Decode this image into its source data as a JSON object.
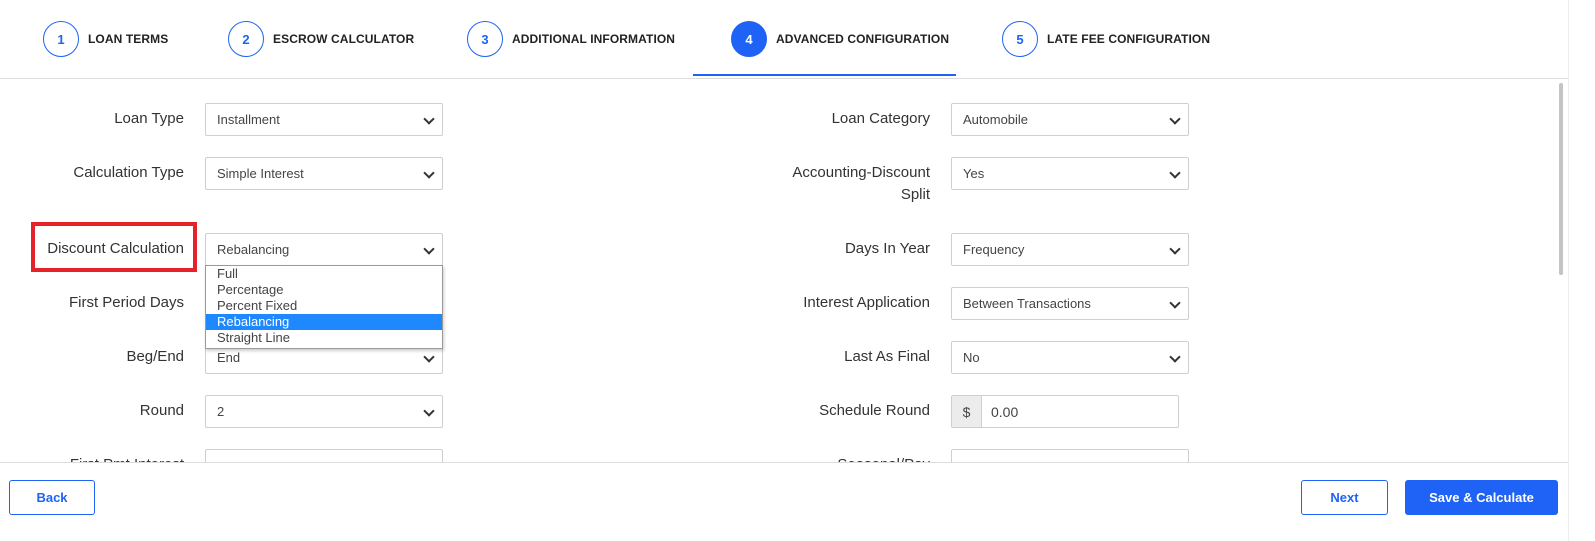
{
  "steps": [
    {
      "number": "1",
      "label": "LOAN TERMS"
    },
    {
      "number": "2",
      "label": "ESCROW CALCULATOR"
    },
    {
      "number": "3",
      "label": "ADDITIONAL INFORMATION"
    },
    {
      "number": "4",
      "label": "ADVANCED CONFIGURATION",
      "active": true
    },
    {
      "number": "5",
      "label": "LATE FEE CONFIGURATION"
    }
  ],
  "left_fields": {
    "loan_type": {
      "label": "Loan Type",
      "value": "Installment"
    },
    "calculation_type": {
      "label": "Calculation Type",
      "value": "Simple Interest"
    },
    "discount_calculation": {
      "label": "Discount Calculation",
      "value": "Rebalancing"
    },
    "first_period_days": {
      "label": "First Period Days",
      "value": ""
    },
    "beg_end": {
      "label": "Beg/End",
      "value": "End"
    },
    "round": {
      "label": "Round",
      "value": "2"
    },
    "first_pmt_interest": {
      "label": "First Pmt Interest",
      "value": ""
    }
  },
  "right_fields": {
    "loan_category": {
      "label": "Loan Category",
      "value": "Automobile"
    },
    "accounting_discount_split": {
      "label_line1": "Accounting-Discount",
      "label_line2": "Split",
      "value": "Yes"
    },
    "days_in_year": {
      "label": "Days In Year",
      "value": "Frequency"
    },
    "interest_application": {
      "label": "Interest Application",
      "value": "Between Transactions"
    },
    "last_as_final": {
      "label": "Last As Final",
      "value": "No"
    },
    "schedule_round": {
      "label": "Schedule Round",
      "prefix": "$",
      "value": "0.00"
    },
    "seasonal_payment": {
      "label": "Seasonal/Pay",
      "value": ""
    }
  },
  "discount_dropdown_options": [
    "Full",
    "Percentage",
    "Percent Fixed",
    "Rebalancing",
    "Straight Line"
  ],
  "discount_dropdown_selected": "Rebalancing",
  "footer": {
    "back_label": "Back",
    "next_label": "Next",
    "save_label": "Save & Calculate"
  },
  "colors": {
    "accent": "#1e63f5",
    "highlight": "#e52229",
    "dropdown_selected": "#1e88ff"
  }
}
